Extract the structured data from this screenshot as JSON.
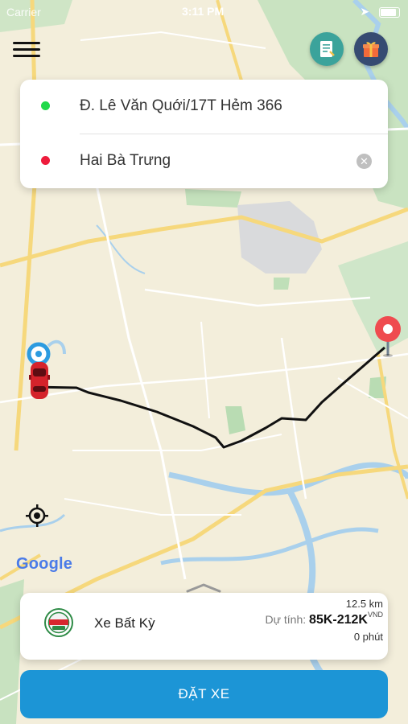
{
  "status_bar": {
    "carrier": "Carrier",
    "time": "3:11 PM"
  },
  "route": {
    "origin": "Đ. Lê Văn Quới/17T Hẻm 366",
    "destination": "Hai Bà Trưng",
    "clear_symbol": "✕"
  },
  "map": {
    "attribution": "Google"
  },
  "vehicle": {
    "name": "Xe Bất Kỳ",
    "distance": "12.5 km",
    "estimate_label": "Dự tính:",
    "price": "85K-212K",
    "currency": "VND",
    "duration": "0 phút"
  },
  "actions": {
    "book": "ĐẶT XE"
  },
  "colors": {
    "accent": "#1c95d6",
    "origin_dot": "#20d94a",
    "destination_dot": "#ee1c3c",
    "route_line": "#111111",
    "doc_button": "#3ba39b",
    "gift_button": "#364b72"
  },
  "icons": [
    "hamburger-icon",
    "document-icon",
    "gift-icon",
    "clear-icon",
    "locate-icon",
    "car-icon",
    "pin-icon",
    "chevron-up-icon"
  ]
}
